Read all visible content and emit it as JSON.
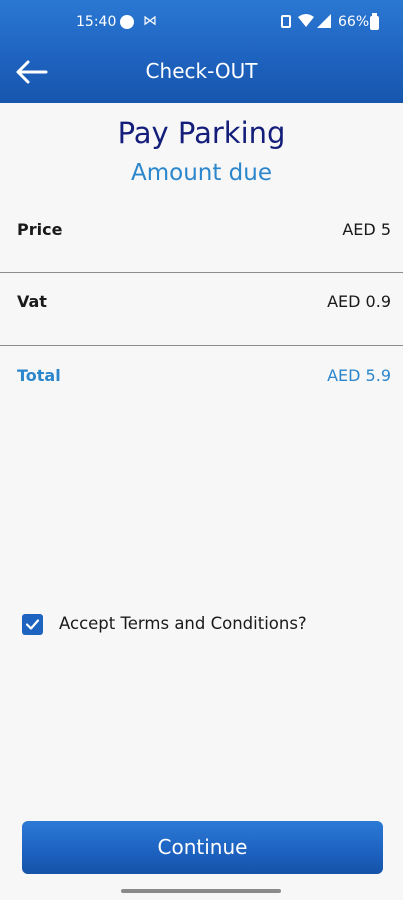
{
  "status_bar": {
    "time": "15:40",
    "battery": "66%"
  },
  "header": {
    "title": "Check-OUT"
  },
  "page": {
    "title": "Pay Parking",
    "subtitle": "Amount due"
  },
  "summary": {
    "price_label": "Price",
    "price_value": "AED 5",
    "vat_label": "Vat",
    "vat_value": "AED 0.9",
    "total_label": "Total",
    "total_value": "AED 5.9"
  },
  "terms": {
    "label": "Accept Terms and Conditions?",
    "checked": true
  },
  "actions": {
    "continue_label": "Continue"
  },
  "colors": {
    "header": "#1f63c0",
    "title": "#141e7a",
    "accent": "#2b86cc"
  }
}
